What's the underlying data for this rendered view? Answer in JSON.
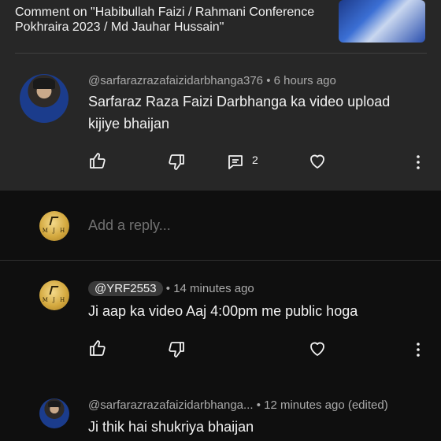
{
  "context": {
    "title": "Comment on \"Habibullah Faizi / Rahmani Conference Pokhraira 2023 / Md Jauhar Hussain\""
  },
  "main_comment": {
    "handle": "@sarfarazrazafaizidarbhanga376",
    "time": "6 hours ago",
    "text": "Sarfaraz Raza Faizi Darbhanga ka video upload kijiye bhaijan",
    "reply_count": "2"
  },
  "reply_box": {
    "logo_text": "M J H",
    "placeholder": "Add a reply..."
  },
  "replies": [
    {
      "handle": "@YRF2553",
      "time": "14 minutes ago",
      "text": "Ji aap ka video Aaj 4:00pm me public hoga",
      "logo_text": "M J H"
    },
    {
      "handle": "@sarfarazrazafaizidarbhanga...",
      "time": "12 minutes ago (edited)",
      "text": "Ji thik hai shukriya bhaijan"
    }
  ]
}
